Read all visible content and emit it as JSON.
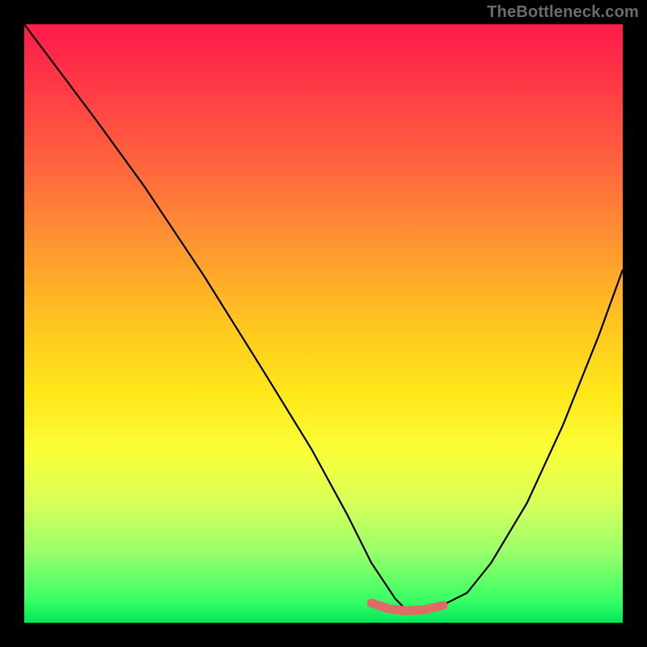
{
  "watermark": "TheBottleneck.com",
  "chart_data": {
    "type": "line",
    "title": "",
    "xlabel": "",
    "ylabel": "",
    "xlim": [
      0,
      100
    ],
    "ylim": [
      0,
      100
    ],
    "grid": false,
    "legend": false,
    "gradient_stops": [
      {
        "pos": 0,
        "color": "#ff1a4b"
      },
      {
        "pos": 12,
        "color": "#ff3f45"
      },
      {
        "pos": 25,
        "color": "#ff6a3d"
      },
      {
        "pos": 38,
        "color": "#ff9a2f"
      },
      {
        "pos": 50,
        "color": "#ffc51f"
      },
      {
        "pos": 62,
        "color": "#ffe81a"
      },
      {
        "pos": 72,
        "color": "#f8ff3a"
      },
      {
        "pos": 80,
        "color": "#d7ff5a"
      },
      {
        "pos": 88,
        "color": "#9bff6a"
      },
      {
        "pos": 96,
        "color": "#3dff66"
      },
      {
        "pos": 100,
        "color": "#00e858"
      }
    ],
    "series": [
      {
        "name": "bottleneck-curve",
        "color": "#000000",
        "stroke_width": 2.2,
        "x": [
          0,
          6,
          12,
          20,
          30,
          40,
          48,
          54,
          58,
          62,
          64,
          66,
          70,
          74,
          78,
          84,
          90,
          96,
          100
        ],
        "values": [
          100,
          92,
          84,
          73,
          58,
          42,
          29,
          18,
          10,
          4,
          2,
          2,
          3,
          5,
          10,
          20,
          33,
          48,
          59
        ]
      },
      {
        "name": "optimal-range",
        "color": "#e06a66",
        "stroke_width": 11,
        "linecap": "round",
        "x": [
          58,
          61,
          64,
          67,
          70
        ],
        "values": [
          3.3,
          2.3,
          2.0,
          2.2,
          2.9
        ]
      }
    ]
  }
}
